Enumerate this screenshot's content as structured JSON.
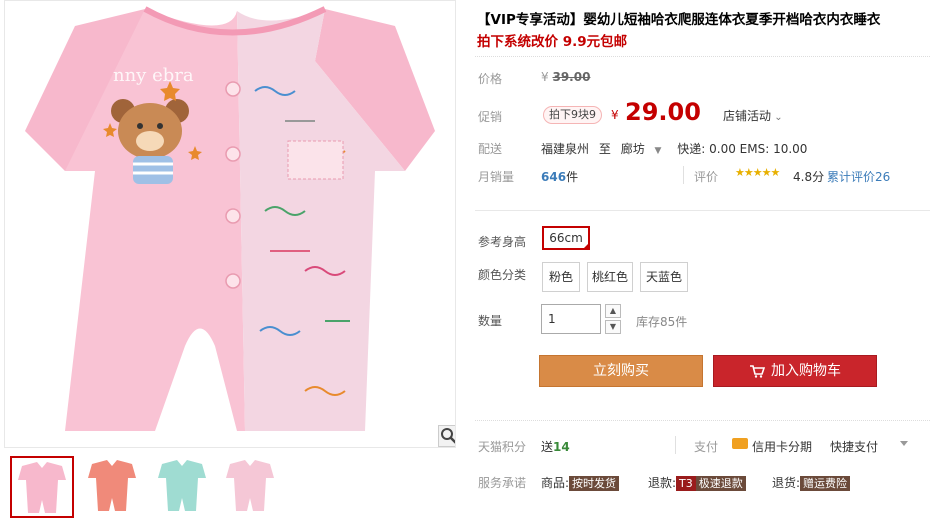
{
  "product": {
    "title": "【VIP专享活动】婴幼儿短袖哈衣爬服连体衣夏季开档哈衣内衣睡衣",
    "subtitle": "拍下系统改价 9.9元包邮",
    "image_text": "nny ebra"
  },
  "price": {
    "label": "价格",
    "original_prefix": "¥",
    "original": "39.00"
  },
  "promo": {
    "label": "促销",
    "tag": "拍下9块9",
    "currency": "¥",
    "price": "29.00",
    "shop_activity": "店铺活动"
  },
  "shipping": {
    "label": "配送",
    "from": "福建泉州",
    "to_word": "至",
    "dest": "廊坊",
    "fees": "快递: 0.00 EMS: 10.00"
  },
  "sales": {
    "label": "月销量",
    "count": "646",
    "unit": "件",
    "rating_label": "评价",
    "stars": "★★★★★",
    "score": "4.8分",
    "review_text": "累计评价26"
  },
  "height": {
    "label": "参考身高",
    "options": [
      "66cm"
    ]
  },
  "color": {
    "label": "颜色分类",
    "options": [
      "粉色",
      "桃红色",
      "天蓝色"
    ]
  },
  "quantity": {
    "label": "数量",
    "value": "1",
    "stock": "库存85件"
  },
  "actions": {
    "buy": "立刻购买",
    "cart": "加入购物车"
  },
  "points": {
    "label": "天猫积分",
    "value_prefix": "送",
    "value": "14",
    "pay_label": "支付",
    "card_text": "信用卡分期",
    "quick_pay": "快捷支付"
  },
  "services": {
    "label": "服务承诺",
    "items": [
      {
        "prefix": "商品:",
        "tag": "按时发货"
      },
      {
        "prefix": "退款:",
        "tag": "T3",
        "tag2": "极速退款"
      },
      {
        "prefix": "退货:",
        "tag": "赠运费险"
      }
    ]
  },
  "colors": {
    "price_red": "#c40000",
    "buy_orange": "#d98b47",
    "cart_red": "#c9252b",
    "link_blue": "#3c7cb9",
    "onesie_pink": "#f7b8cc"
  }
}
